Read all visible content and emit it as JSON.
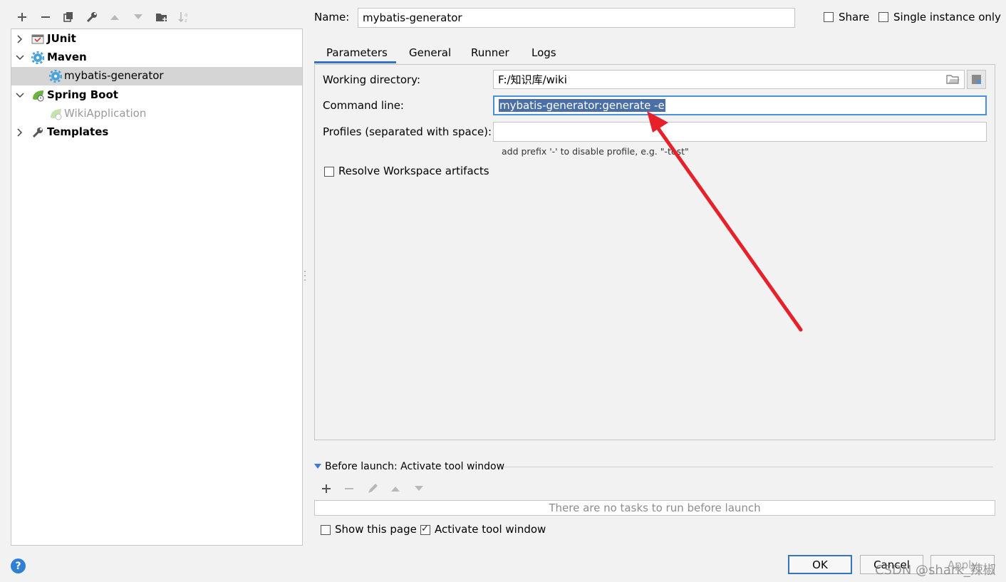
{
  "toolbar": {
    "icons": [
      "add-icon",
      "remove-icon",
      "copy-icon",
      "wrench-icon",
      "move-up-icon",
      "move-down-icon",
      "new-folder-icon",
      "sort-icon"
    ]
  },
  "tree": {
    "items": [
      {
        "label": "JUnit",
        "icon": "junit-icon",
        "expanded": false,
        "bold": true
      },
      {
        "label": "Maven",
        "icon": "maven-gear-icon",
        "expanded": true,
        "bold": true
      },
      {
        "label": "mybatis-generator",
        "icon": "maven-gear-icon",
        "selected": true
      },
      {
        "label": "Spring Boot",
        "icon": "spring-leaf-icon",
        "expanded": true,
        "bold": true
      },
      {
        "label": "WikiApplication",
        "icon": "spring-leaf-icon",
        "disabled": true
      },
      {
        "label": "Templates",
        "icon": "wrench-icon",
        "expanded": false,
        "bold": true
      }
    ]
  },
  "name_field": {
    "label": "Name:",
    "value": "mybatis-generator"
  },
  "share": {
    "label": "Share",
    "checked": false
  },
  "single_instance": {
    "label": "Single instance only",
    "checked": false
  },
  "tabs": [
    {
      "label": "Parameters",
      "active": true
    },
    {
      "label": "General"
    },
    {
      "label": "Runner"
    },
    {
      "label": "Logs"
    }
  ],
  "params": {
    "working_directory": {
      "label": "Working directory:",
      "value": "F:/知识库/wiki"
    },
    "command_line": {
      "label": "Command line:",
      "value": "mybatis-generator:generate -e"
    },
    "profiles": {
      "label": "Profiles (separated with space):",
      "value": "",
      "hint": "add prefix '-' to disable profile, e.g. \"-test\""
    },
    "resolve_workspace": {
      "label": "Resolve Workspace artifacts",
      "checked": false
    }
  },
  "before_launch": {
    "title": "Before launch: Activate tool window",
    "empty_text": "There are no tasks to run before launch",
    "show_page": {
      "label": "Show this page",
      "checked": false
    },
    "activate_tool_window": {
      "label": "Activate tool window",
      "checked": true
    }
  },
  "buttons": {
    "ok": "OK",
    "cancel": "Cancel",
    "apply": "Apply"
  },
  "watermark": "CSDN @shark_辣椒",
  "colors": {
    "accent": "#3574c5",
    "selection": "#4a6fa5",
    "arrow": "#e8202a"
  }
}
